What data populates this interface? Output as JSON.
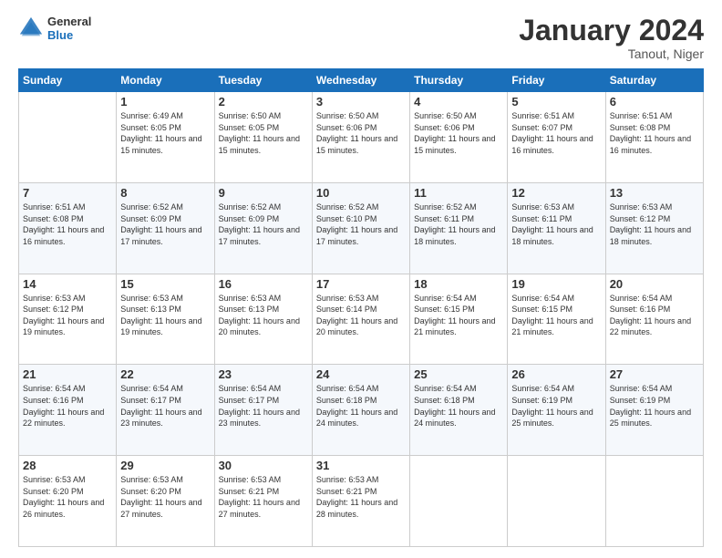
{
  "logo": {
    "general": "General",
    "blue": "Blue"
  },
  "header": {
    "title": "January 2024",
    "subtitle": "Tanout, Niger"
  },
  "weekdays": [
    "Sunday",
    "Monday",
    "Tuesday",
    "Wednesday",
    "Thursday",
    "Friday",
    "Saturday"
  ],
  "weeks": [
    [
      {
        "day": "",
        "sunrise": "",
        "sunset": "",
        "daylight": ""
      },
      {
        "day": "1",
        "sunrise": "Sunrise: 6:49 AM",
        "sunset": "Sunset: 6:05 PM",
        "daylight": "Daylight: 11 hours and 15 minutes."
      },
      {
        "day": "2",
        "sunrise": "Sunrise: 6:50 AM",
        "sunset": "Sunset: 6:05 PM",
        "daylight": "Daylight: 11 hours and 15 minutes."
      },
      {
        "day": "3",
        "sunrise": "Sunrise: 6:50 AM",
        "sunset": "Sunset: 6:06 PM",
        "daylight": "Daylight: 11 hours and 15 minutes."
      },
      {
        "day": "4",
        "sunrise": "Sunrise: 6:50 AM",
        "sunset": "Sunset: 6:06 PM",
        "daylight": "Daylight: 11 hours and 15 minutes."
      },
      {
        "day": "5",
        "sunrise": "Sunrise: 6:51 AM",
        "sunset": "Sunset: 6:07 PM",
        "daylight": "Daylight: 11 hours and 16 minutes."
      },
      {
        "day": "6",
        "sunrise": "Sunrise: 6:51 AM",
        "sunset": "Sunset: 6:08 PM",
        "daylight": "Daylight: 11 hours and 16 minutes."
      }
    ],
    [
      {
        "day": "7",
        "sunrise": "Sunrise: 6:51 AM",
        "sunset": "Sunset: 6:08 PM",
        "daylight": "Daylight: 11 hours and 16 minutes."
      },
      {
        "day": "8",
        "sunrise": "Sunrise: 6:52 AM",
        "sunset": "Sunset: 6:09 PM",
        "daylight": "Daylight: 11 hours and 17 minutes."
      },
      {
        "day": "9",
        "sunrise": "Sunrise: 6:52 AM",
        "sunset": "Sunset: 6:09 PM",
        "daylight": "Daylight: 11 hours and 17 minutes."
      },
      {
        "day": "10",
        "sunrise": "Sunrise: 6:52 AM",
        "sunset": "Sunset: 6:10 PM",
        "daylight": "Daylight: 11 hours and 17 minutes."
      },
      {
        "day": "11",
        "sunrise": "Sunrise: 6:52 AM",
        "sunset": "Sunset: 6:11 PM",
        "daylight": "Daylight: 11 hours and 18 minutes."
      },
      {
        "day": "12",
        "sunrise": "Sunrise: 6:53 AM",
        "sunset": "Sunset: 6:11 PM",
        "daylight": "Daylight: 11 hours and 18 minutes."
      },
      {
        "day": "13",
        "sunrise": "Sunrise: 6:53 AM",
        "sunset": "Sunset: 6:12 PM",
        "daylight": "Daylight: 11 hours and 18 minutes."
      }
    ],
    [
      {
        "day": "14",
        "sunrise": "Sunrise: 6:53 AM",
        "sunset": "Sunset: 6:12 PM",
        "daylight": "Daylight: 11 hours and 19 minutes."
      },
      {
        "day": "15",
        "sunrise": "Sunrise: 6:53 AM",
        "sunset": "Sunset: 6:13 PM",
        "daylight": "Daylight: 11 hours and 19 minutes."
      },
      {
        "day": "16",
        "sunrise": "Sunrise: 6:53 AM",
        "sunset": "Sunset: 6:13 PM",
        "daylight": "Daylight: 11 hours and 20 minutes."
      },
      {
        "day": "17",
        "sunrise": "Sunrise: 6:53 AM",
        "sunset": "Sunset: 6:14 PM",
        "daylight": "Daylight: 11 hours and 20 minutes."
      },
      {
        "day": "18",
        "sunrise": "Sunrise: 6:54 AM",
        "sunset": "Sunset: 6:15 PM",
        "daylight": "Daylight: 11 hours and 21 minutes."
      },
      {
        "day": "19",
        "sunrise": "Sunrise: 6:54 AM",
        "sunset": "Sunset: 6:15 PM",
        "daylight": "Daylight: 11 hours and 21 minutes."
      },
      {
        "day": "20",
        "sunrise": "Sunrise: 6:54 AM",
        "sunset": "Sunset: 6:16 PM",
        "daylight": "Daylight: 11 hours and 22 minutes."
      }
    ],
    [
      {
        "day": "21",
        "sunrise": "Sunrise: 6:54 AM",
        "sunset": "Sunset: 6:16 PM",
        "daylight": "Daylight: 11 hours and 22 minutes."
      },
      {
        "day": "22",
        "sunrise": "Sunrise: 6:54 AM",
        "sunset": "Sunset: 6:17 PM",
        "daylight": "Daylight: 11 hours and 23 minutes."
      },
      {
        "day": "23",
        "sunrise": "Sunrise: 6:54 AM",
        "sunset": "Sunset: 6:17 PM",
        "daylight": "Daylight: 11 hours and 23 minutes."
      },
      {
        "day": "24",
        "sunrise": "Sunrise: 6:54 AM",
        "sunset": "Sunset: 6:18 PM",
        "daylight": "Daylight: 11 hours and 24 minutes."
      },
      {
        "day": "25",
        "sunrise": "Sunrise: 6:54 AM",
        "sunset": "Sunset: 6:18 PM",
        "daylight": "Daylight: 11 hours and 24 minutes."
      },
      {
        "day": "26",
        "sunrise": "Sunrise: 6:54 AM",
        "sunset": "Sunset: 6:19 PM",
        "daylight": "Daylight: 11 hours and 25 minutes."
      },
      {
        "day": "27",
        "sunrise": "Sunrise: 6:54 AM",
        "sunset": "Sunset: 6:19 PM",
        "daylight": "Daylight: 11 hours and 25 minutes."
      }
    ],
    [
      {
        "day": "28",
        "sunrise": "Sunrise: 6:53 AM",
        "sunset": "Sunset: 6:20 PM",
        "daylight": "Daylight: 11 hours and 26 minutes."
      },
      {
        "day": "29",
        "sunrise": "Sunrise: 6:53 AM",
        "sunset": "Sunset: 6:20 PM",
        "daylight": "Daylight: 11 hours and 27 minutes."
      },
      {
        "day": "30",
        "sunrise": "Sunrise: 6:53 AM",
        "sunset": "Sunset: 6:21 PM",
        "daylight": "Daylight: 11 hours and 27 minutes."
      },
      {
        "day": "31",
        "sunrise": "Sunrise: 6:53 AM",
        "sunset": "Sunset: 6:21 PM",
        "daylight": "Daylight: 11 hours and 28 minutes."
      },
      {
        "day": "",
        "sunrise": "",
        "sunset": "",
        "daylight": ""
      },
      {
        "day": "",
        "sunrise": "",
        "sunset": "",
        "daylight": ""
      },
      {
        "day": "",
        "sunrise": "",
        "sunset": "",
        "daylight": ""
      }
    ]
  ]
}
